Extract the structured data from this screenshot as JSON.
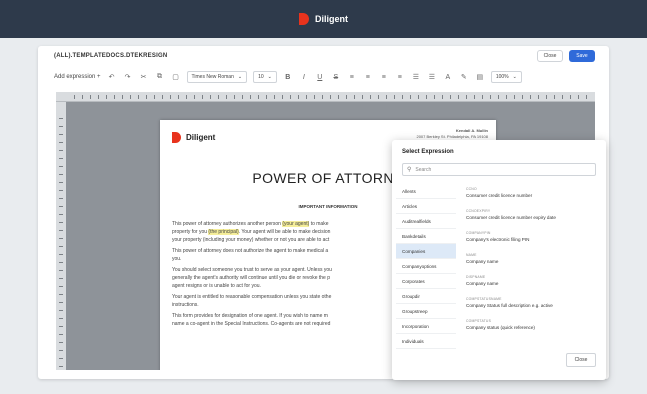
{
  "app": {
    "brand": "Diligent"
  },
  "document": {
    "title": "(ALL).TEMPLATEDOCS.DTEKRESIGN",
    "close_label": "Close",
    "save_label": "Save"
  },
  "toolbar": {
    "add_expression": "Add expression +",
    "font": "Times New Roman",
    "size": "10",
    "zoom": "100%"
  },
  "page": {
    "logo": "Diligent",
    "address_line1": "Kendall A. Mullin",
    "address_line2": "2007 Berkley St. Philadelphia, PA 19108",
    "heading": "POWER OF ATTORNE",
    "subheading": "IMPORTANT INFORMATION",
    "p1a": "This power of attorney authorizes another person ",
    "p1_hl1": "(your agent)",
    "p1b": " to make",
    "p1c": "property for you ",
    "p1_hl2": "(the principal)",
    "p1d": ". Your agent will be able to make decision",
    "p1e": "your property (including your money) whether or not you are able to act",
    "p2a": "This power of attorney does not authorize the agent to make medical a",
    "p2b": "you.",
    "p3a": "You should select someone you trust to serve as your agent. Unless you",
    "p3b": "generally the agent's authority will continue until you die or revoke the p",
    "p3c": "agent resigns or is unable to act for you.",
    "p4a": "Your agent is entitled to reasonable compensation unless you state othe",
    "p4b": "instructions.",
    "p5a": "This form provides for designation of one agent. If you wish to name m",
    "p5b": "name a co-agent in the Special Instructions. Co-agents are not required"
  },
  "popup": {
    "title": "Select Expression",
    "search_placeholder": "Search",
    "categories": [
      "Allents",
      "Articles",
      "Auditrealfields",
      "Bankdetails",
      "Companies",
      "Companyoptions",
      "Corporates",
      "Groupdir",
      "Groupstreep",
      "Incorporation",
      "Individuals"
    ],
    "active_category": "Companies",
    "fields": [
      {
        "code": "CCNO",
        "desc": "Consumer credit licence number"
      },
      {
        "code": "CCNOEXPIRY",
        "desc": "Consumer credit licence number expiry date"
      },
      {
        "code": "COMPANYPIN",
        "desc": "Company's electronic filing PIN"
      },
      {
        "code": "NAME",
        "desc": "Company name"
      },
      {
        "code": "DISPNAME",
        "desc": "Company name"
      },
      {
        "code": "COMPSTATUSNAME",
        "desc": "Company Status full description e.g. active"
      },
      {
        "code": "COMPSTATUS",
        "desc": "Company status (quick reference)"
      }
    ],
    "close_label": "Close"
  }
}
